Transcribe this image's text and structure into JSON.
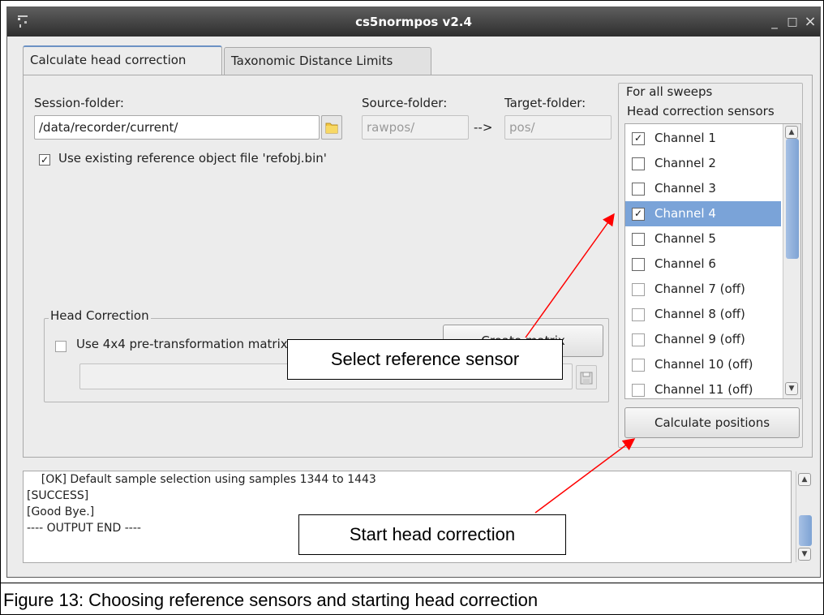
{
  "window": {
    "title": "cs5normpos v2.4",
    "minimize_glyph": "_",
    "maximize_glyph": "□",
    "close_glyph": "×"
  },
  "tabs": [
    {
      "label": "Calculate head correction",
      "active": true
    },
    {
      "label": "Taxonomic Distance Limits",
      "active": false
    }
  ],
  "folders": {
    "session_label": "Session-folder:",
    "session_value": "/data/recorder/current/",
    "source_label": "Source-folder:",
    "source_value": "rawpos/",
    "arrow": "-->",
    "target_label": "Target-folder:",
    "target_value": "pos/"
  },
  "refobj_checkbox": {
    "label": "Use existing reference object file 'refobj.bin'",
    "checked": true
  },
  "head_correction": {
    "legend": "Head Correction",
    "pretransform_label": "Use 4x4 pre-transformation matrix",
    "pretransform_checked": false,
    "create_matrix_label": "Create matrix",
    "matrix_path_value": ""
  },
  "sweeps": {
    "legend": "For all sweeps",
    "sublabel": "Head correction sensors",
    "channels": [
      {
        "label": "Channel 1",
        "checked": true,
        "selected": false,
        "off": false
      },
      {
        "label": "Channel 2",
        "checked": false,
        "selected": false,
        "off": false
      },
      {
        "label": "Channel 3",
        "checked": false,
        "selected": false,
        "off": false
      },
      {
        "label": "Channel 4",
        "checked": true,
        "selected": true,
        "off": false
      },
      {
        "label": "Channel 5",
        "checked": false,
        "selected": false,
        "off": false
      },
      {
        "label": "Channel 6",
        "checked": false,
        "selected": false,
        "off": false
      },
      {
        "label": "Channel 7 (off)",
        "checked": false,
        "selected": false,
        "off": true
      },
      {
        "label": "Channel 8 (off)",
        "checked": false,
        "selected": false,
        "off": true
      },
      {
        "label": "Channel 9 (off)",
        "checked": false,
        "selected": false,
        "off": true
      },
      {
        "label": "Channel 10 (off)",
        "checked": false,
        "selected": false,
        "off": true
      },
      {
        "label": "Channel 11 (off)",
        "checked": false,
        "selected": false,
        "off": true
      }
    ],
    "calculate_label": "Calculate positions"
  },
  "output": {
    "lines": [
      "    [OK] Default sample selection using samples 1344 to 1443",
      "[SUCCESS]",
      "[Good Bye.]",
      "---- OUTPUT END ----"
    ]
  },
  "annotations": {
    "select_sensor": "Select reference sensor",
    "start_correction": "Start head correction",
    "arrow_color": "#ff0000"
  },
  "caption": "Figure 13: Choosing reference sensors and starting head correction",
  "icons": [
    "app-icon",
    "minimize-icon",
    "maximize-icon",
    "close-icon",
    "folder-icon",
    "save-file-icon",
    "check-icon",
    "scroll-up-icon",
    "scroll-down-icon"
  ]
}
